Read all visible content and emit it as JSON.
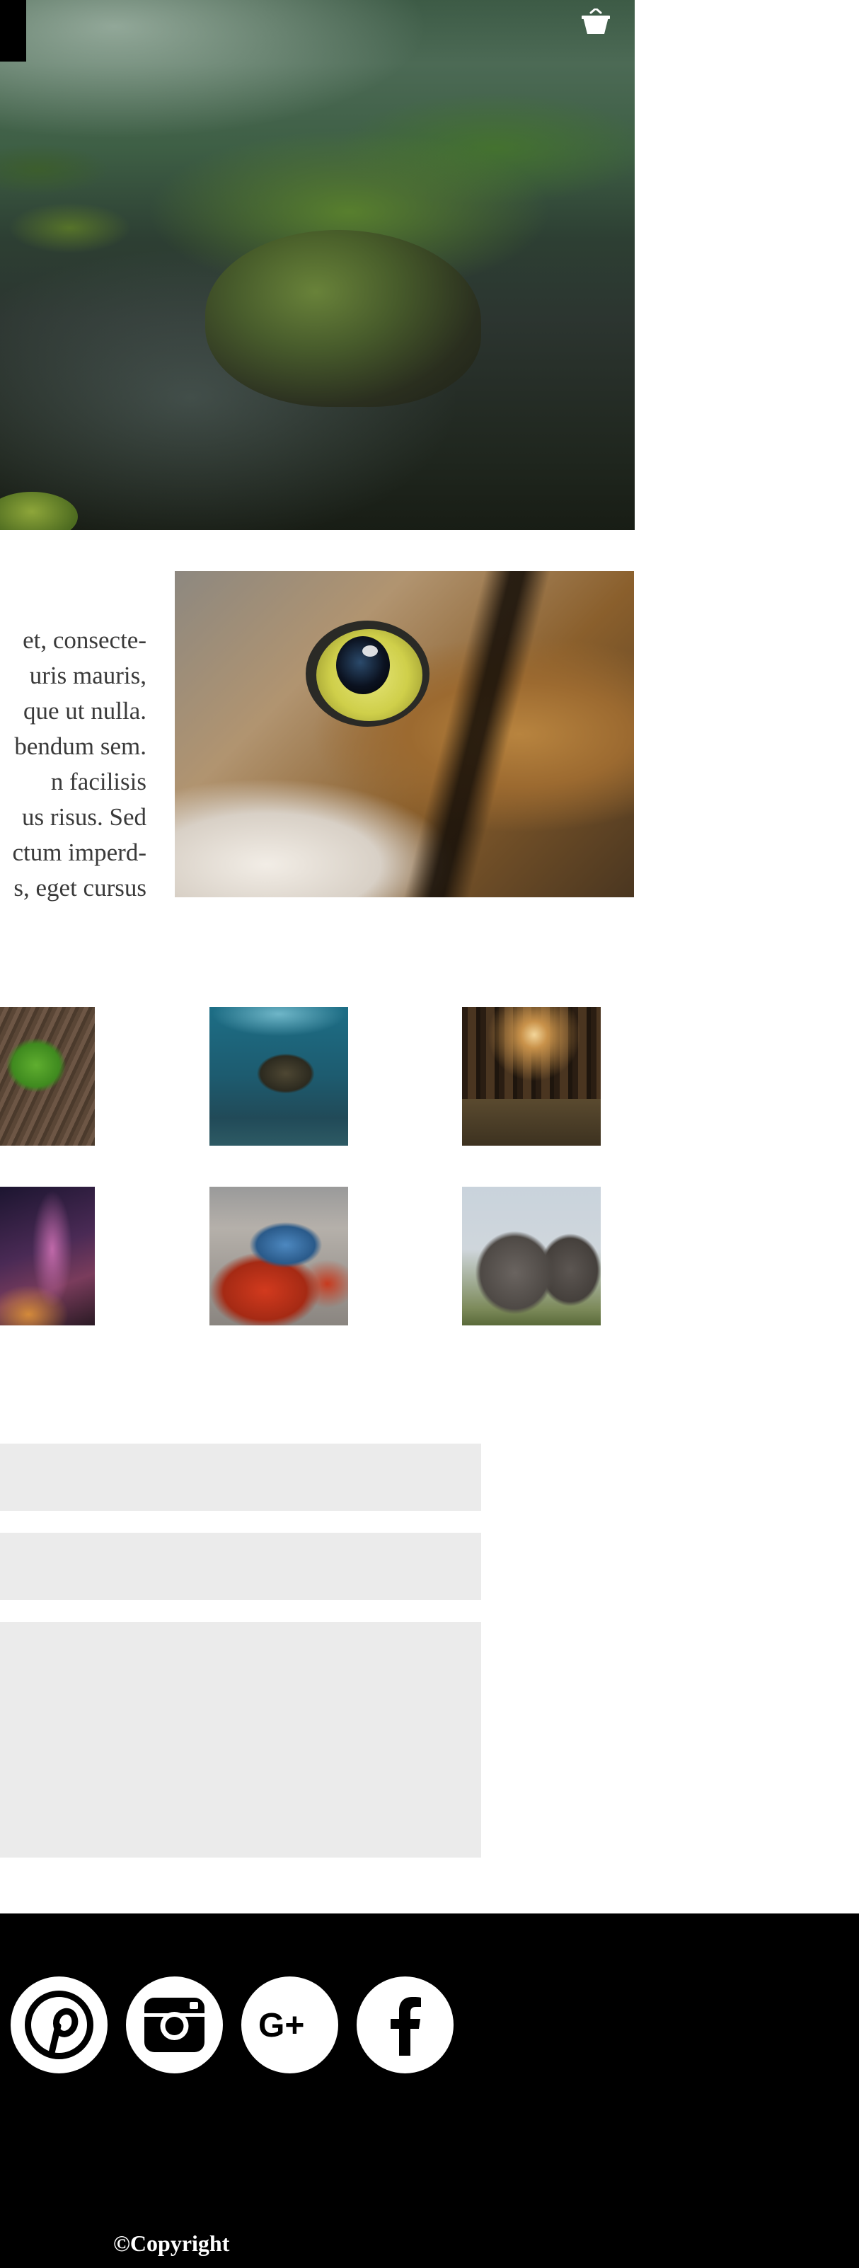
{
  "header": {
    "cart_icon": "shopping-basket-icon"
  },
  "hero": {
    "image": "misty forest stream with moss-covered rock"
  },
  "about": {
    "paragraph_lines": [
      "et, consecte-",
      "uris mauris,",
      "que ut nulla.",
      "bendum sem.",
      "n facilisis",
      "us risus. Sed",
      "ctum imperd-",
      "s, eget cursus"
    ],
    "image": "close-up of owl eye"
  },
  "gallery": {
    "items": [
      "green leaf on bark",
      "sea turtle underwater",
      "sunlit forest",
      "milky way night sky",
      "red and blue crab",
      "elephants"
    ]
  },
  "contact_form": {
    "field_1_value": "",
    "field_2_value": "",
    "message_value": ""
  },
  "footer": {
    "social": [
      "pinterest-icon",
      "instagram-icon",
      "google-plus-icon",
      "facebook-icon"
    ],
    "copyright": "©Copyright"
  },
  "colors": {
    "footer_bg": "#000000",
    "field_bg": "#ebebeb",
    "text": "#3a3a3a"
  }
}
